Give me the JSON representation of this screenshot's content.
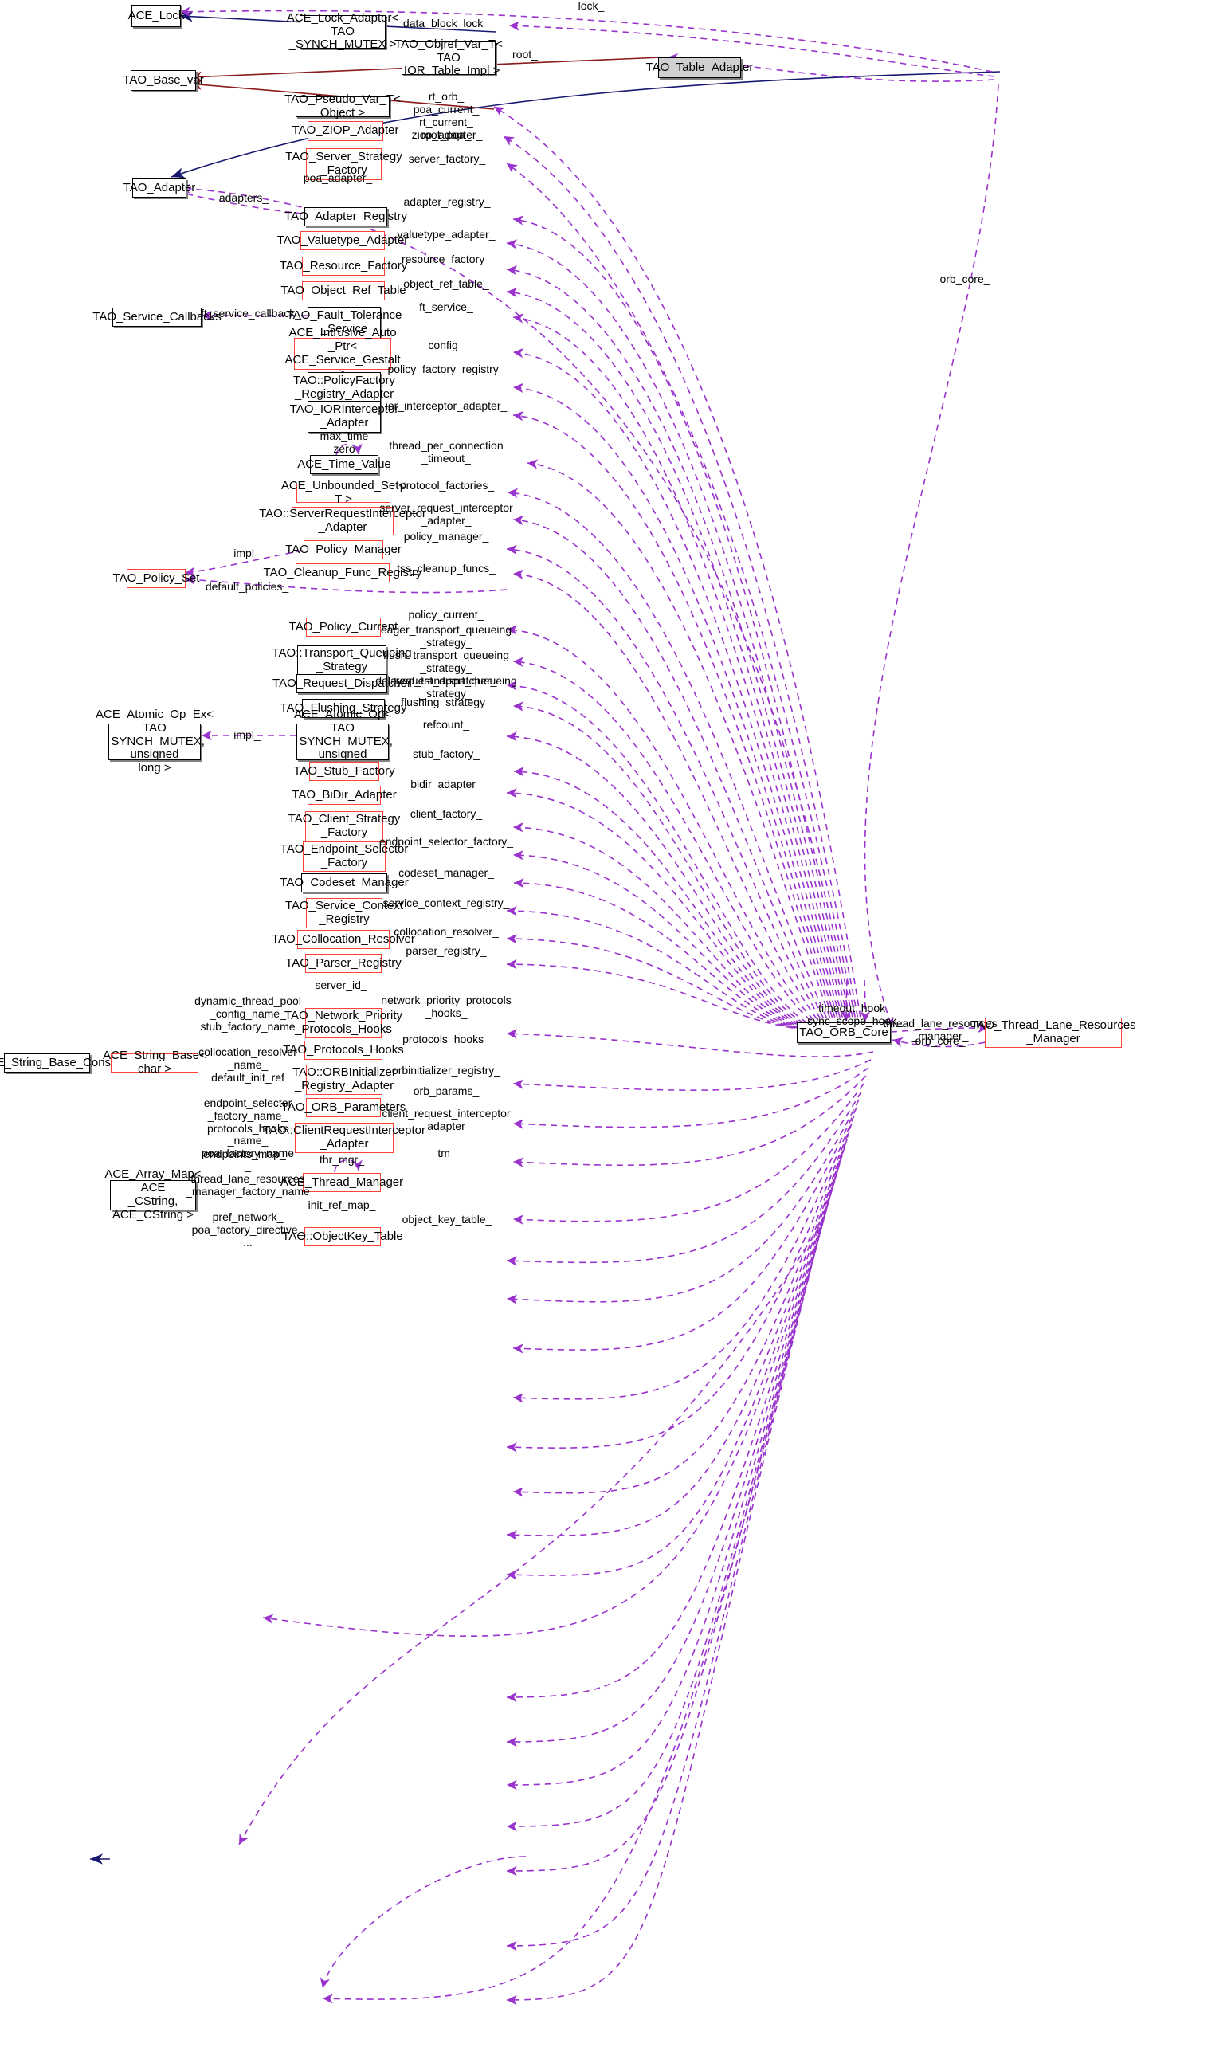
{
  "diagram": {
    "type": "collaboration-diagram",
    "focus_class": "TAO_Table_Adapter",
    "colors": {
      "dependency_edge": "#9a32cd",
      "public_inheritance_blue": "#191970",
      "inheritance_red": "#8b1a1a",
      "highlight_border": "#ff4136",
      "focus_fill": "#d0d0d0"
    }
  },
  "nodes": [
    {
      "id": "ace_lock",
      "label": "ACE_Lock"
    },
    {
      "id": "ace_lock_adapter",
      "label": "ACE_Lock_Adapter< TAO\n_SYNCH_MUTEX >"
    },
    {
      "id": "tao_objref_var_t",
      "label": "TAO_Objref_Var_T< TAO\n_IOR_Table_Impl >"
    },
    {
      "id": "tao_table_adapter",
      "label": "TAO_Table_Adapter"
    },
    {
      "id": "tao_base_var",
      "label": "TAO_Base_var"
    },
    {
      "id": "tao_pseudo_var_t",
      "label": "TAO_Pseudo_Var_T< Object >"
    },
    {
      "id": "tao_ziop_adapter",
      "label": "TAO_ZIOP_Adapter"
    },
    {
      "id": "tao_server_strategy_factory",
      "label": "TAO_Server_Strategy\n_Factory"
    },
    {
      "id": "tao_adapter",
      "label": "TAO_Adapter"
    },
    {
      "id": "tao_adapter_registry",
      "label": "TAO_Adapter_Registry"
    },
    {
      "id": "tao_valuetype_adapter",
      "label": "TAO_Valuetype_Adapter"
    },
    {
      "id": "tao_resource_factory",
      "label": "TAO_Resource_Factory"
    },
    {
      "id": "tao_object_ref_table",
      "label": "TAO_Object_Ref_Table"
    },
    {
      "id": "tao_service_callbacks",
      "label": "TAO_Service_Callbacks"
    },
    {
      "id": "tao_fault_tolerance_service",
      "label": "TAO_Fault_Tolerance\n_Service"
    },
    {
      "id": "ace_intrusive_auto_ptr",
      "label": "ACE_Intrusive_Auto\n_Ptr< ACE_Service_Gestalt >"
    },
    {
      "id": "tao_policyfactory_registry_adapter",
      "label": "TAO::PolicyFactory\n_Registry_Adapter"
    },
    {
      "id": "tao_iorinterceptor_adapter",
      "label": "TAO_IORInterceptor\n_Adapter"
    },
    {
      "id": "ace_time_value",
      "label": "ACE_Time_Value"
    },
    {
      "id": "ace_unbounded_set",
      "label": "ACE_Unbounded_Set< T >"
    },
    {
      "id": "tao_serverrequestinterceptor_adapter",
      "label": "TAO::ServerRequestInterceptor\n_Adapter"
    },
    {
      "id": "tao_policy_manager",
      "label": "TAO_Policy_Manager"
    },
    {
      "id": "tao_policy_set",
      "label": "TAO_Policy_Set"
    },
    {
      "id": "tao_cleanup_func_registry",
      "label": "TAO_Cleanup_Func_Registry"
    },
    {
      "id": "tao_policy_current",
      "label": "TAO_Policy_Current"
    },
    {
      "id": "tao_transport_queueing_strategy",
      "label": "TAO::Transport_Queueing\n_Strategy"
    },
    {
      "id": "tao_request_dispatcher",
      "label": "TAO_Request_Dispatcher"
    },
    {
      "id": "tao_flushing_strategy",
      "label": "TAO_Flushing_Strategy"
    },
    {
      "id": "ace_atomic_op_ex",
      "label": "ACE_Atomic_Op_Ex< TAO\n_SYNCH_MUTEX, unsigned\nlong >"
    },
    {
      "id": "ace_atomic_op",
      "label": "ACE_Atomic_Op< TAO\n_SYNCH_MUTEX, unsigned\nlong >"
    },
    {
      "id": "tao_orb_core",
      "label": "TAO_ORB_Core"
    },
    {
      "id": "tao_thread_lane_resources_manager",
      "label": "TAO_Thread_Lane_Resources\n_Manager"
    },
    {
      "id": "tao_stub_factory",
      "label": "TAO_Stub_Factory"
    },
    {
      "id": "tao_bidir_adapter",
      "label": "TAO_BiDir_Adapter"
    },
    {
      "id": "tao_client_strategy_factory",
      "label": "TAO_Client_Strategy\n_Factory"
    },
    {
      "id": "tao_endpoint_selector_factory",
      "label": "TAO_Endpoint_Selector\n_Factory"
    },
    {
      "id": "tao_codeset_manager",
      "label": "TAO_Codeset_Manager"
    },
    {
      "id": "tao_service_context_registry",
      "label": "TAO_Service_Context\n_Registry"
    },
    {
      "id": "tao_collocation_resolver",
      "label": "TAO_Collocation_Resolver"
    },
    {
      "id": "tao_parser_registry",
      "label": "TAO_Parser_Registry"
    },
    {
      "id": "ace_string_base_const",
      "label": "ACE_String_Base_Const"
    },
    {
      "id": "ace_string_base_char",
      "label": "ACE_String_Base< char >"
    },
    {
      "id": "tao_network_priority_protocols_hooks",
      "label": "TAO_Network_Priority\n_Protocols_Hooks"
    },
    {
      "id": "tao_protocols_hooks",
      "label": "TAO_Protocols_Hooks"
    },
    {
      "id": "tao_orbinitializer_registry_adapter",
      "label": "TAO::ORBInitializer\n_Registry_Adapter"
    },
    {
      "id": "tao_orb_parameters",
      "label": "TAO_ORB_Parameters"
    },
    {
      "id": "tao_clientrequestinterceptor_adapter",
      "label": "TAO::ClientRequestInterceptor\n_Adapter"
    },
    {
      "id": "ace_array_map",
      "label": "ACE_Array_Map< ACE\n_CString, ACE_CString >"
    },
    {
      "id": "ace_thread_manager",
      "label": "ACE_Thread_Manager"
    },
    {
      "id": "tao_objectkey_table",
      "label": "TAO::ObjectKey_Table"
    }
  ],
  "edge_labels": [
    {
      "id": "lbl_lock",
      "text": "lock_"
    },
    {
      "id": "lbl_data_block_lock",
      "text": "data_block_lock_"
    },
    {
      "id": "lbl_root",
      "text": "root_"
    },
    {
      "id": "lbl_rt_orb",
      "text": "rt_orb_\npoa_current_\nrt_current_\nroot_poa_"
    },
    {
      "id": "lbl_ziop_adapter",
      "text": "ziop_adapter_"
    },
    {
      "id": "lbl_server_factory",
      "text": "server_factory_"
    },
    {
      "id": "lbl_poa_adapter",
      "text": "poa_adapter_"
    },
    {
      "id": "lbl_adapters",
      "text": "adapters_"
    },
    {
      "id": "lbl_adapter_registry",
      "text": "adapter_registry_"
    },
    {
      "id": "lbl_valuetype_adapter",
      "text": "valuetype_adapter_"
    },
    {
      "id": "lbl_resource_factory",
      "text": "resource_factory_"
    },
    {
      "id": "lbl_object_ref_table",
      "text": "object_ref_table_"
    },
    {
      "id": "lbl_ft_service_callback",
      "text": "ft_service_callback_"
    },
    {
      "id": "lbl_ft_service",
      "text": "ft_service_"
    },
    {
      "id": "lbl_config",
      "text": "config_"
    },
    {
      "id": "lbl_policy_factory_registry",
      "text": "policy_factory_registry_"
    },
    {
      "id": "lbl_ior_interceptor_adapter",
      "text": "ior_interceptor_adapter_"
    },
    {
      "id": "lbl_max_time_zero",
      "text": "max_time\nzero"
    },
    {
      "id": "lbl_thread_per_connection_timeout",
      "text": "thread_per_connection\n_timeout_"
    },
    {
      "id": "lbl_protocol_factories",
      "text": "protocol_factories_"
    },
    {
      "id": "lbl_server_request_interceptor_adapter",
      "text": "server_request_interceptor\n_adapter_"
    },
    {
      "id": "lbl_policy_manager",
      "text": "policy_manager_"
    },
    {
      "id": "lbl_impl_policy",
      "text": "impl_"
    },
    {
      "id": "lbl_tss_cleanup_funcs",
      "text": "tss_cleanup_funcs_"
    },
    {
      "id": "lbl_default_policies",
      "text": "default_policies_"
    },
    {
      "id": "lbl_policy_current",
      "text": "policy_current_"
    },
    {
      "id": "lbl_queueing_strategies",
      "text": "eager_transport_queueing\n_strategy_\nflush_transport_queueing\n_strategy_\ndelayed_transport_queueing\n_strategy_"
    },
    {
      "id": "lbl_request_dispatcher",
      "text": "request_dispatcher_"
    },
    {
      "id": "lbl_flushing_strategy",
      "text": "flushing_strategy_"
    },
    {
      "id": "lbl_refcount",
      "text": "refcount_"
    },
    {
      "id": "lbl_impl_atomic",
      "text": "impl_"
    },
    {
      "id": "lbl_stub_factory",
      "text": "stub_factory_"
    },
    {
      "id": "lbl_bidir_adapter",
      "text": "bidir_adapter_"
    },
    {
      "id": "lbl_client_factory",
      "text": "client_factory_"
    },
    {
      "id": "lbl_endpoint_selector_factory",
      "text": "endpoint_selector_factory_"
    },
    {
      "id": "lbl_codeset_manager",
      "text": "codeset_manager_"
    },
    {
      "id": "lbl_service_context_registry",
      "text": "service_context_registry_"
    },
    {
      "id": "lbl_collocation_resolver",
      "text": "collocation_resolver_"
    },
    {
      "id": "lbl_parser_registry",
      "text": "parser_registry_"
    },
    {
      "id": "lbl_server_id",
      "text": "server_id_"
    },
    {
      "id": "lbl_network_priority_protocols_hooks",
      "text": "network_priority_protocols\n_hooks_"
    },
    {
      "id": "lbl_protocols_hooks",
      "text": "protocols_hooks_"
    },
    {
      "id": "lbl_orbinitializer_registry",
      "text": "orbinitializer_registry_"
    },
    {
      "id": "lbl_orb_params",
      "text": "orb_params_"
    },
    {
      "id": "lbl_client_request_interceptor_adapter",
      "text": "client_request_interceptor\n_adapter_"
    },
    {
      "id": "lbl_tm",
      "text": "tm_"
    },
    {
      "id": "lbl_thr_mgr",
      "text": "thr_mgr_"
    },
    {
      "id": "lbl_init_ref_map",
      "text": "init_ref_map_"
    },
    {
      "id": "lbl_object_key_table",
      "text": "object_key_table_"
    },
    {
      "id": "lbl_endpoints_map",
      "text": "endpoints_map_"
    },
    {
      "id": "lbl_string_fields",
      "text": "dynamic_thread_pool\n_config_name_\nstub_factory_name\n_\ncollocation_resolver\n_name_\ndefault_init_ref\n_\nendpoint_selector\n_factory_name_\nprotocols_hooks\n_name_\npoa_factory_name\n_\nthread_lane_resources\n_manager_factory_name\n_\npref_network_\npoa_factory_directive_\n..."
    },
    {
      "id": "lbl_timeout_hook",
      "text": "timeout_hook_\nsync_scope_hook_"
    },
    {
      "id": "lbl_thread_lane_resources_manager",
      "text": "thread_lane_resources\n_manager_"
    },
    {
      "id": "lbl_orb_core_right",
      "text": "orb_core_"
    },
    {
      "id": "lbl_orb_core_top",
      "text": "orb_core_"
    }
  ]
}
